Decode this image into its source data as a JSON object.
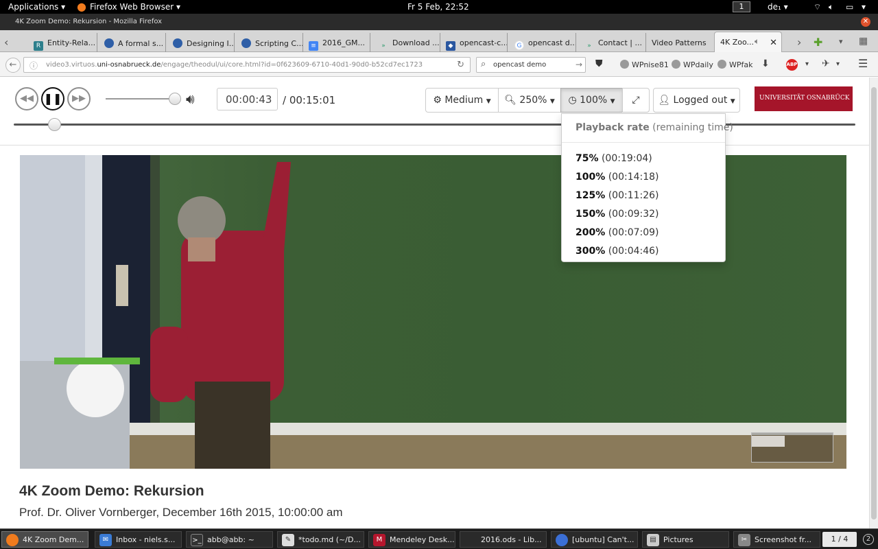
{
  "panel": {
    "applications": "Applications",
    "app_name": "Firefox Web Browser",
    "clock": "Fr  5 Feb, 22:52",
    "workspace": "1",
    "keyboard": "de₁"
  },
  "window": {
    "title": "4K Zoom Demo: Rekursion - Mozilla Firefox"
  },
  "tabs": [
    {
      "label": "Entity-Rela...",
      "icon": "R"
    },
    {
      "label": "A formal s...",
      "icon": "doc"
    },
    {
      "label": "Designing I...",
      "icon": "doc"
    },
    {
      "label": "Scripting C...",
      "icon": "doc"
    },
    {
      "label": "2016_GM...",
      "icon": "gdoc"
    },
    {
      "label": "Download ...",
      "icon": "arrow"
    },
    {
      "label": "opencast-c...",
      "icon": "shield"
    },
    {
      "label": "opencast d...",
      "icon": "google"
    },
    {
      "label": "Contact | ...",
      "icon": "arrow"
    },
    {
      "label": "Video Patterns",
      "icon": ""
    },
    {
      "label": "4K Zoo...",
      "icon": "",
      "active": true
    }
  ],
  "nav": {
    "url_prefix": "video3.virtuos.",
    "url_domain": "uni-osnabrueck.de",
    "url_path": "/engage/theodul/ui/core.html?id=0f623609-6710-40d1-90d0-b52cd7ec1723",
    "search_value": "opencast demo",
    "bookmarks": [
      "WPnise81",
      "WPdaily",
      "WPfak"
    ]
  },
  "player": {
    "current_time": "00:00:43",
    "total_time": "/ 00:15:01",
    "quality_label": "Medium",
    "zoom_label": "250%",
    "rate_label": "100%",
    "login_label": "Logged out",
    "logo_text": "UNIVERSITÄT  OSNABRÜCK",
    "volume_level": 1.0,
    "seek_fraction": 0.048
  },
  "rate_menu": {
    "title": "Playback rate",
    "subtitle": "(remaining time)",
    "options": [
      {
        "rate": "75%",
        "remaining": "(00:19:04)"
      },
      {
        "rate": "100%",
        "remaining": "(00:14:18)"
      },
      {
        "rate": "125%",
        "remaining": "(00:11:26)"
      },
      {
        "rate": "150%",
        "remaining": "(00:09:32)"
      },
      {
        "rate": "200%",
        "remaining": "(00:07:09)"
      },
      {
        "rate": "300%",
        "remaining": "(00:04:46)"
      }
    ]
  },
  "video_info": {
    "title": "4K Zoom Demo: Rekursion",
    "meta": "Prof. Dr. Oliver Vornberger,  December 16th 2015, 10:00:00 am"
  },
  "taskbar": [
    {
      "label": "4K Zoom Dem...",
      "active": true
    },
    {
      "label": "Inbox - niels.s..."
    },
    {
      "label": "abb@abb: ~"
    },
    {
      "label": "*todo.md (~/D..."
    },
    {
      "label": "Mendeley Desk..."
    },
    {
      "label": "2016.ods - Lib..."
    },
    {
      "label": "[ubuntu] Can't..."
    },
    {
      "label": "Pictures"
    },
    {
      "label": "Screenshot fr..."
    }
  ],
  "pager": "1 / 4",
  "colors": {
    "brand": "#a5152a",
    "board": "#3c5e35"
  }
}
